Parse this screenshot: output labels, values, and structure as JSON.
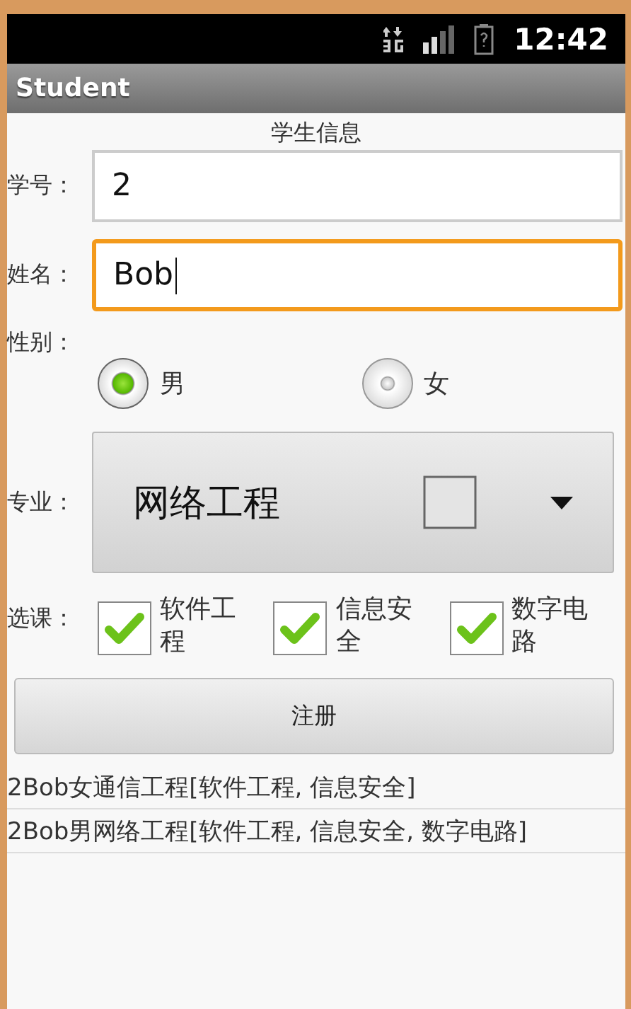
{
  "status_bar": {
    "time": "12:42"
  },
  "window": {
    "title": "Student"
  },
  "form": {
    "heading": "学生信息",
    "fields": [
      {
        "label": "学号：",
        "value": "2",
        "focused": false
      },
      {
        "label": "姓名：",
        "value": "Bob",
        "focused": true
      }
    ],
    "gender": {
      "label": "性别：",
      "options": [
        {
          "label": "男",
          "selected": true
        },
        {
          "label": "女",
          "selected": false
        }
      ]
    },
    "major": {
      "label": "专业：",
      "value": "网络工程"
    },
    "courses": {
      "label": "选课：",
      "options": [
        {
          "label": "软件工程",
          "checked": true
        },
        {
          "label": "信息安全",
          "checked": true
        },
        {
          "label": "数字电路",
          "checked": true
        }
      ]
    },
    "submit": "注册"
  },
  "results": [
    "2Bob女通信工程[软件工程, 信息安全]",
    "2Bob男网络工程[软件工程, 信息安全, 数字电路]"
  ]
}
